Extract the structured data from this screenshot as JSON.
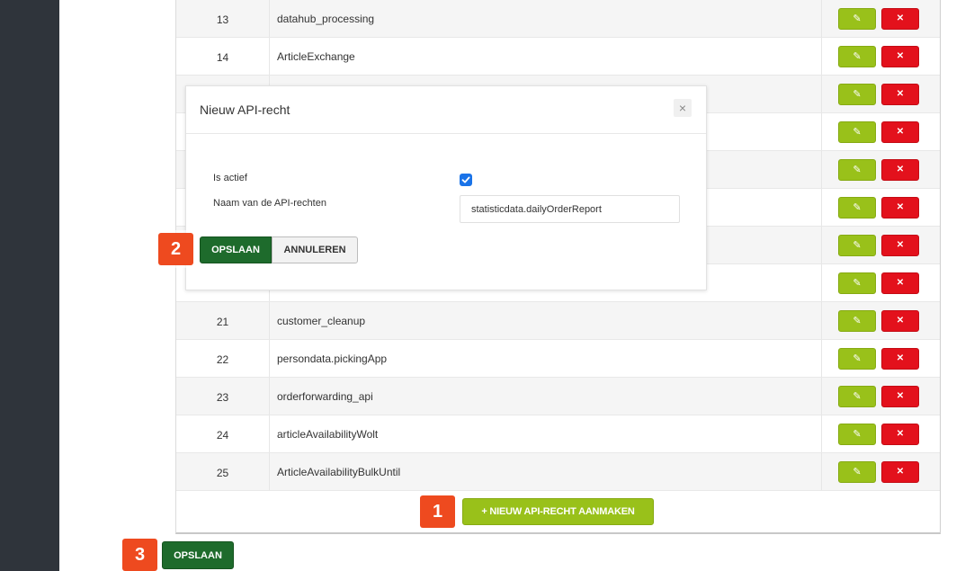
{
  "table": {
    "rows": [
      {
        "id": "13",
        "name": "datahub_processing"
      },
      {
        "id": "14",
        "name": "ArticleExchange"
      },
      {
        "id": "",
        "name": ""
      },
      {
        "id": "",
        "name": ""
      },
      {
        "id": "",
        "name": ""
      },
      {
        "id": "",
        "name": ""
      },
      {
        "id": "",
        "name": ""
      },
      {
        "id": "",
        "name": ""
      },
      {
        "id": "21",
        "name": "customer_cleanup"
      },
      {
        "id": "22",
        "name": "persondata.pickingApp"
      },
      {
        "id": "23",
        "name": "orderforwarding_api"
      },
      {
        "id": "24",
        "name": "articleAvailabilityWolt"
      },
      {
        "id": "25",
        "name": "ArticleAvailabilityBulkUntil"
      }
    ],
    "edit_icon": "pencil-icon",
    "delete_icon": "close-icon",
    "edit_glyph": "✎",
    "delete_glyph": "✕",
    "new_button_label": "+ NIEUW API-RECHT AANMAKEN"
  },
  "page": {
    "save_label": "OPSLAAN"
  },
  "modal": {
    "title": "Nieuw API-recht",
    "close_glyph": "×",
    "is_active_label": "Is actief",
    "is_active_checked": true,
    "name_label": "Naam van de API-rechten",
    "name_value": "statisticdata.dailyOrderReport",
    "save_label": "OPSLAAN",
    "cancel_label": "ANNULEREN"
  },
  "markers": {
    "one": "1",
    "two": "2",
    "three": "3"
  },
  "colors": {
    "sidebar": "#2f343b",
    "edit_green": "#99c11a",
    "delete_red": "#e3111c",
    "save_dark_green": "#1e6b2c",
    "marker_orange": "#ee4a1f"
  }
}
